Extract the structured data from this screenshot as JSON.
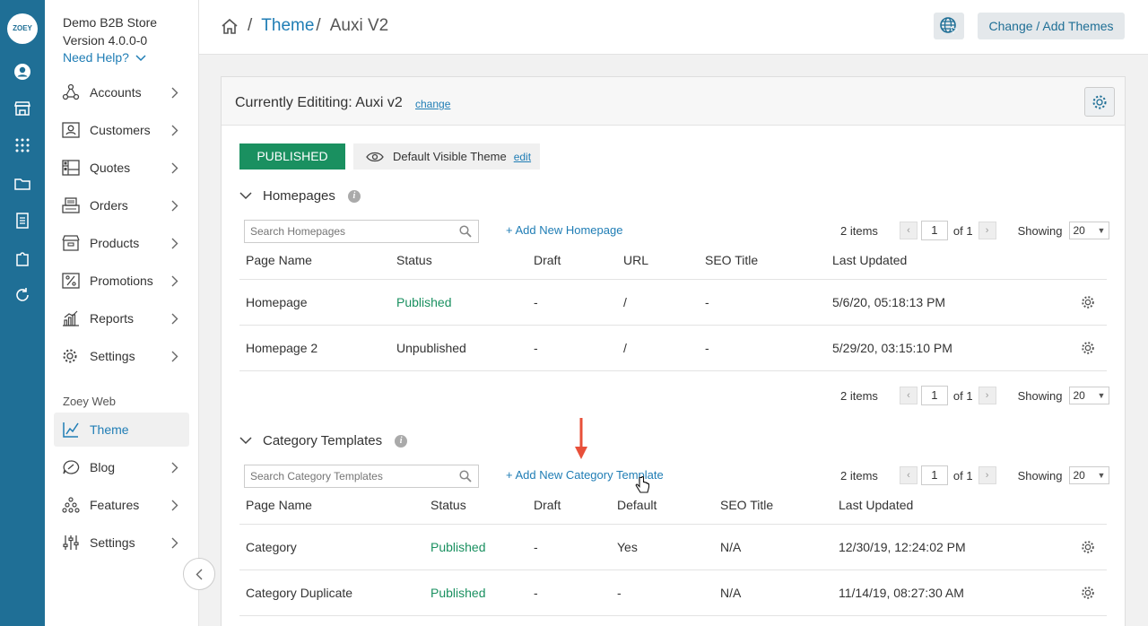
{
  "rail": {
    "logo": "ZOEY"
  },
  "sidebar": {
    "store_name": "Demo B2B Store",
    "version": "Version 4.0.0-0",
    "help": "Need Help?",
    "items": [
      {
        "label": "Accounts"
      },
      {
        "label": "Customers"
      },
      {
        "label": "Quotes"
      },
      {
        "label": "Orders"
      },
      {
        "label": "Products"
      },
      {
        "label": "Promotions"
      },
      {
        "label": "Reports"
      },
      {
        "label": "Settings"
      }
    ],
    "section_label": "Zoey Web",
    "web_items": [
      {
        "label": "Theme"
      },
      {
        "label": "Blog"
      },
      {
        "label": "Features"
      },
      {
        "label": "Settings"
      }
    ]
  },
  "header": {
    "crumb_theme": "Theme",
    "crumb_current": "Auxi V2",
    "change_add_themes": "Change / Add Themes"
  },
  "panel": {
    "title": "Currently Edititing: Auxi v2",
    "change_link": "change",
    "published_label": "PUBLISHED",
    "default_visible": "Default Visible Theme",
    "edit_link": "edit"
  },
  "homepages": {
    "title": "Homepages",
    "search_placeholder": "Search Homepages",
    "add_link": "+ Add New Homepage",
    "pager": {
      "items": "2 items",
      "page": "1",
      "of": "of 1",
      "showing": "Showing",
      "per_page": "20"
    },
    "columns": [
      "Page Name",
      "Status",
      "Draft",
      "URL",
      "SEO Title",
      "Last Updated"
    ],
    "rows": [
      {
        "name": "Homepage",
        "status": "Published",
        "draft": "-",
        "url": "/",
        "seo": "-",
        "updated": "5/6/20, 05:18:13 PM"
      },
      {
        "name": "Homepage 2",
        "status": "Unpublished",
        "draft": "-",
        "url": "/",
        "seo": "-",
        "updated": "5/29/20, 03:15:10 PM"
      }
    ]
  },
  "category_templates": {
    "title": "Category Templates",
    "search_placeholder": "Search Category Templates",
    "add_link": "+ Add New Category Template",
    "pager": {
      "items": "2 items",
      "page": "1",
      "of": "of 1",
      "showing": "Showing",
      "per_page": "20"
    },
    "columns": [
      "Page Name",
      "Status",
      "Draft",
      "Default",
      "SEO Title",
      "Last Updated"
    ],
    "rows": [
      {
        "name": "Category",
        "status": "Published",
        "draft": "-",
        "default": "Yes",
        "seo": "N/A",
        "updated": "12/30/19, 12:24:02 PM"
      },
      {
        "name": "Category Duplicate",
        "status": "Published",
        "draft": "-",
        "default": "-",
        "seo": "N/A",
        "updated": "11/14/19, 08:27:30 AM"
      }
    ]
  },
  "colors": {
    "rail": "#1f6f96",
    "link": "#1f7db5",
    "published": "#1a9060",
    "arrow": "#e8503a"
  },
  "icons": [
    "home-icon",
    "globe-cursor-icon",
    "gear-icon",
    "eye-icon",
    "search-icon",
    "chevron-down-icon",
    "chevron-right-icon",
    "info-icon",
    "arrow-down-icon",
    "hand-cursor-icon"
  ]
}
